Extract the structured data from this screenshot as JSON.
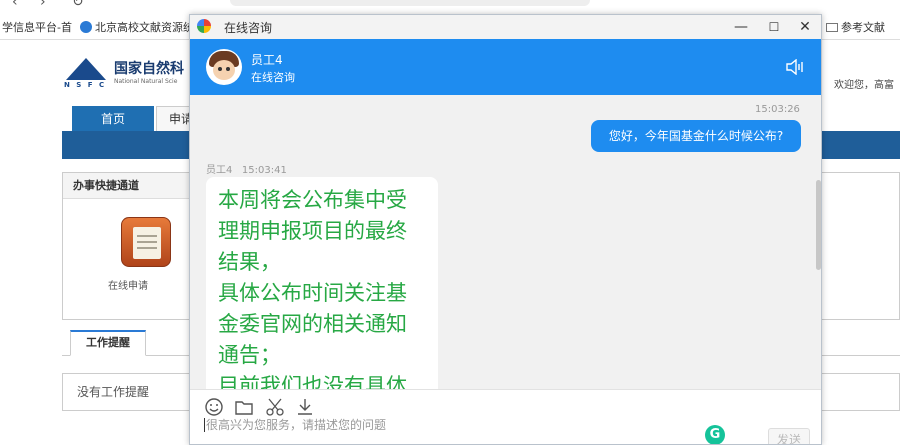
{
  "browser": {
    "bookmarks": [
      {
        "label": "学信息平台-首"
      },
      {
        "label": "北京高校文献资源统"
      },
      {
        "label": "参考文献"
      }
    ]
  },
  "site": {
    "org_name_cn": "国家自然科",
    "org_name_en": "National Natural Scie",
    "logo_abbr": "N S F C",
    "welcome": "欢迎您，高富",
    "tabs": [
      {
        "label": "首页",
        "active": true
      },
      {
        "label": "申请",
        "active": false
      }
    ],
    "quick_panel_title": "办事快捷通道",
    "quick_app_label": "在线申请",
    "work_tab_label": "工作提醒",
    "work_empty": "没有工作提醒"
  },
  "chat": {
    "window_title": "在线咨询",
    "window_buttons": {
      "minimize": "—",
      "maximize": "☐",
      "close": "✕"
    },
    "agent_name": "员工4",
    "agent_status": "在线咨询",
    "messages": [
      {
        "direction": "out",
        "time": "15:03:26",
        "text": "您好，今年国基金什么时候公布?"
      },
      {
        "direction": "in",
        "sender": "员工4",
        "time": "15:03:41",
        "text": "本周将会公布集中受理期申报项目的最终结果，\n具体公布时间关注基金委官网的相关通知通告；\n目前我们也没有具体"
      }
    ],
    "in_meta": "员工4   15:03:41",
    "input_placeholder": "很高兴为您服务，请描述您的问题",
    "send_label": "发送",
    "grammarly_badge": "G",
    "toolbar_icons": [
      "emoji-icon",
      "folder-icon",
      "scissors-icon",
      "download-icon"
    ],
    "colors": {
      "primary": "#1e8cf0",
      "agent_text": "#27a844"
    }
  }
}
